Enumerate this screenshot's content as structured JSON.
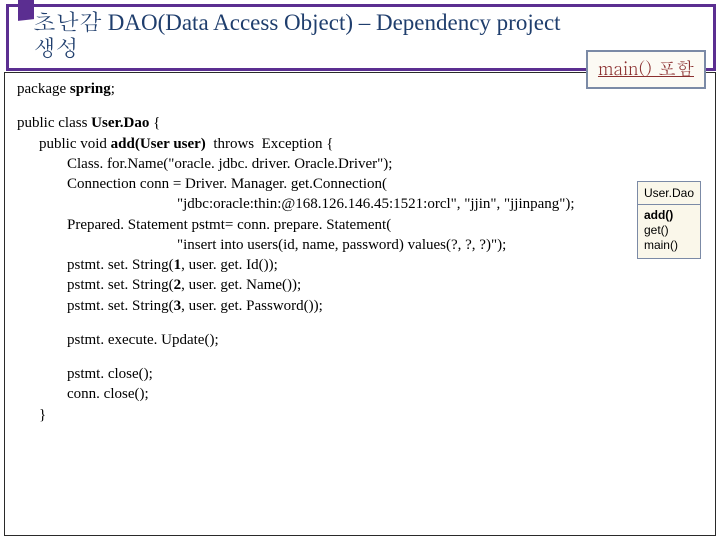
{
  "title": {
    "line1": "초난감 DAO(Data Access Object) – Dependency  project",
    "line2": "생성"
  },
  "main_badge": "main() 포함",
  "class_card": {
    "name": "User.Dao",
    "methods": [
      "add()",
      "get()",
      "main()"
    ]
  },
  "code": {
    "package_kw": "package ",
    "package_name": "spring",
    "semicolon": ";",
    "class_decl_1": "public class ",
    "class_decl_name": "User.Dao",
    "class_decl_2": " {",
    "add_sig_1": "public void ",
    "add_sig_name": "add(User user)",
    "add_sig_2": "  throws  Exception {",
    "l_forName": "Class. for.Name(\"oracle. jdbc. driver. Oracle.Driver\");",
    "l_conn": "Connection conn = Driver. Manager. get.Connection(",
    "l_conn2": "\"jdbc:oracle:thin:@168.126.146.45:1521:orcl\", \"jjin\", \"jjinpang\");",
    "l_pstmt": "Prepared. Statement pstmt= conn. prepare. Statement(",
    "l_pstmt2": "\"insert into users(id, name, password) values(?, ?, ?)\");",
    "l_s1a": "pstmt. set. String(",
    "l_s1b": "1",
    "l_s1c": ", user. get. Id());",
    "l_s2a": "pstmt. set. String(",
    "l_s2b": "2",
    "l_s2c": ", user. get. Name());",
    "l_s3a": "pstmt. set. String(",
    "l_s3b": "3",
    "l_s3c": ", user. get. Password());",
    "l_exec": "pstmt. execute. Update();",
    "l_close1": "pstmt. close();",
    "l_close2": "conn. close();",
    "l_brace": "}"
  }
}
